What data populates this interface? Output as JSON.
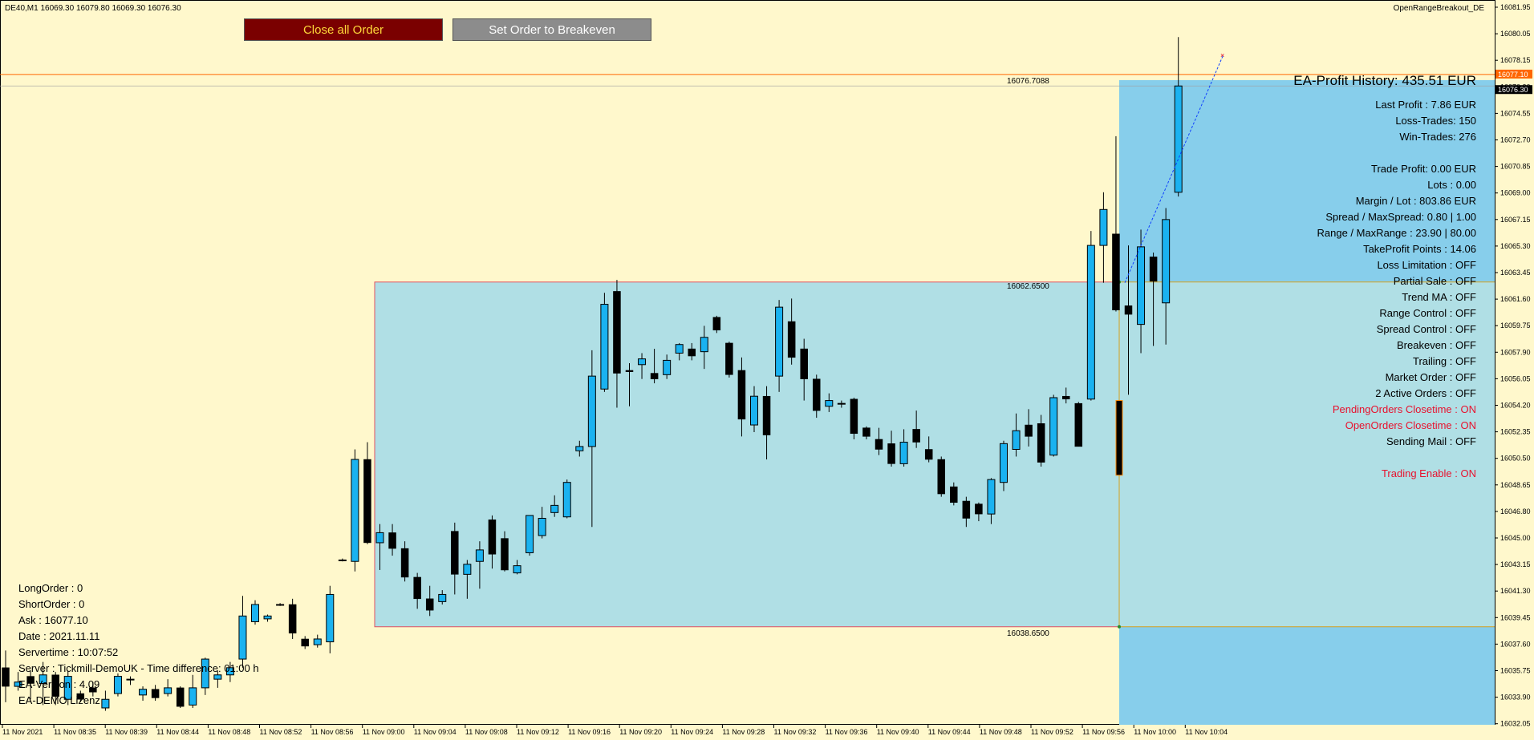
{
  "header": {
    "symbol_info": "DE40,M1  16069.30 16079.80 16069.30 16076.30",
    "ea_name": "OpenRangeBreakout_DE"
  },
  "buttons": {
    "close_all": "Close all Order",
    "breakeven": "Set Order to Breakeven"
  },
  "levels": {
    "high_label": "16076.7088",
    "range_high_label": "16062.6500",
    "range_low_label": "16038.6500",
    "ask_badge": "16077.10",
    "bid_badge": "16076.30"
  },
  "price_axis": [
    "16081.95",
    "16080.05",
    "16078.15",
    "16076.30",
    "16074.55",
    "16072.70",
    "16070.85",
    "16069.00",
    "16067.15",
    "16065.30",
    "16063.45",
    "16061.60",
    "16059.75",
    "16057.90",
    "16056.05",
    "16054.20",
    "16052.35",
    "16050.50",
    "16048.65",
    "16046.80",
    "16045.00",
    "16043.15",
    "16041.30",
    "16039.45",
    "16037.60",
    "16035.75",
    "16033.90",
    "16032.05"
  ],
  "time_axis": [
    "11 Nov 2021",
    "11 Nov 08:35",
    "11 Nov 08:39",
    "11 Nov 08:44",
    "11 Nov 08:48",
    "11 Nov 08:52",
    "11 Nov 08:56",
    "11 Nov 09:00",
    "11 Nov 09:04",
    "11 Nov 09:08",
    "11 Nov 09:12",
    "11 Nov 09:16",
    "11 Nov 09:20",
    "11 Nov 09:24",
    "11 Nov 09:28",
    "11 Nov 09:32",
    "11 Nov 09:36",
    "11 Nov 09:40",
    "11 Nov 09:44",
    "11 Nov 09:48",
    "11 Nov 09:52",
    "11 Nov 09:56",
    "11 Nov 10:00",
    "11 Nov 10:04"
  ],
  "ea_panel": {
    "title": "EA-Profit History: 435.51 EUR",
    "lines": [
      {
        "text": "Last Profit : 7.86 EUR",
        "red": false
      },
      {
        "text": "Loss-Trades:  150",
        "red": false
      },
      {
        "text": "Win-Trades:   276",
        "red": false
      },
      {
        "text": "",
        "red": false
      },
      {
        "text": "Trade Profit:   0.00 EUR",
        "red": false
      },
      {
        "text": "Lots : 0.00",
        "red": false
      },
      {
        "text": "Margin / Lot :   803.86 EUR",
        "red": false
      },
      {
        "text": "Spread / MaxSpread: 0.80 | 1.00",
        "red": false
      },
      {
        "text": "Range / MaxRange : 23.90 | 80.00",
        "red": false
      },
      {
        "text": "TakeProfit Points : 14.06",
        "red": false
      },
      {
        "text": "Loss Limitation : OFF",
        "red": false
      },
      {
        "text": "Partial Sale : OFF",
        "red": false
      },
      {
        "text": "Trend MA : OFF",
        "red": false
      },
      {
        "text": "Range Control : OFF",
        "red": false
      },
      {
        "text": "Spread Control : OFF",
        "red": false
      },
      {
        "text": "Breakeven : OFF",
        "red": false
      },
      {
        "text": "Trailing : OFF",
        "red": false
      },
      {
        "text": "Market Order : OFF",
        "red": false
      },
      {
        "text": "2 Active Orders : OFF",
        "red": false
      },
      {
        "text": "PendingOrders Closetime :  ON",
        "red": true
      },
      {
        "text": "OpenOrders Closetime :  ON",
        "red": true
      },
      {
        "text": "Sending Mail : OFF",
        "red": false
      },
      {
        "text": "",
        "red": false
      },
      {
        "text": "Trading Enable :  ON",
        "red": true
      }
    ]
  },
  "account_info": [
    "LongOrder   : 0",
    "ShortOrder : 0",
    "Ask : 16077.10",
    "Date : 2021.11.11",
    "Servertime : 10:07:52",
    "Server : Tickmill-DemoUK - Time difference: 01:00 h",
    "EA-Version : 4.09",
    "EA-DEMO Lizenz"
  ],
  "colors": {
    "background": "#fff8cc",
    "range_box": "#b0dfe5",
    "breakout_zone": "#87ceeb",
    "bull_candle": "#1ab2f0",
    "bear_candle": "#000000",
    "ask_line": "#ff6600"
  },
  "chart_data": {
    "type": "candlestick",
    "price_range": [
      16032.05,
      16081.95
    ],
    "candles": [
      {
        "o": 16035.8,
        "h": 16037.0,
        "l": 16033.4,
        "c": 16034.5
      },
      {
        "o": 16034.5,
        "h": 16035.5,
        "l": 16034.2,
        "c": 16034.8
      },
      {
        "o": 16035.2,
        "h": 16035.6,
        "l": 16033.6,
        "c": 16034.7
      },
      {
        "o": 16034.7,
        "h": 16036.2,
        "l": 16033.2,
        "c": 16035.3
      },
      {
        "o": 16035.3,
        "h": 16035.5,
        "l": 16033.2,
        "c": 16033.8
      },
      {
        "o": 16033.6,
        "h": 16035.6,
        "l": 16033.2,
        "c": 16035.2
      },
      {
        "o": 16034.0,
        "h": 16034.2,
        "l": 16033.4,
        "c": 16033.6
      },
      {
        "o": 16034.4,
        "h": 16034.8,
        "l": 16033.8,
        "c": 16034.1
      },
      {
        "o": 16033.0,
        "h": 16034.2,
        "l": 16032.8,
        "c": 16033.6
      },
      {
        "o": 16034.0,
        "h": 16035.4,
        "l": 16033.8,
        "c": 16035.2
      },
      {
        "o": 16035.0,
        "h": 16035.2,
        "l": 16034.6,
        "c": 16035.0
      },
      {
        "o": 16033.9,
        "h": 16034.5,
        "l": 16033.5,
        "c": 16034.3
      },
      {
        "o": 16034.3,
        "h": 16034.6,
        "l": 16033.5,
        "c": 16033.7
      },
      {
        "o": 16034.0,
        "h": 16035.0,
        "l": 16033.8,
        "c": 16034.4
      },
      {
        "o": 16034.4,
        "h": 16034.5,
        "l": 16033.0,
        "c": 16033.1
      },
      {
        "o": 16033.2,
        "h": 16035.3,
        "l": 16033.0,
        "c": 16034.4
      },
      {
        "o": 16034.4,
        "h": 16036.5,
        "l": 16033.9,
        "c": 16036.4
      },
      {
        "o": 16035.0,
        "h": 16035.6,
        "l": 16034.4,
        "c": 16035.3
      },
      {
        "o": 16035.3,
        "h": 16036.2,
        "l": 16034.8,
        "c": 16035.8
      },
      {
        "o": 16036.4,
        "h": 16040.8,
        "l": 16035.8,
        "c": 16039.4
      },
      {
        "o": 16039.0,
        "h": 16040.5,
        "l": 16038.8,
        "c": 16040.2
      },
      {
        "o": 16039.2,
        "h": 16039.5,
        "l": 16039.0,
        "c": 16039.4
      },
      {
        "o": 16040.2,
        "h": 16040.3,
        "l": 16040.1,
        "c": 16040.2
      },
      {
        "o": 16040.2,
        "h": 16040.6,
        "l": 16037.8,
        "c": 16038.2
      },
      {
        "o": 16037.8,
        "h": 16038.0,
        "l": 16037.1,
        "c": 16037.3
      },
      {
        "o": 16037.4,
        "h": 16038.1,
        "l": 16037.2,
        "c": 16037.8
      },
      {
        "o": 16037.6,
        "h": 16041.5,
        "l": 16036.8,
        "c": 16040.9
      },
      {
        "o": 16043.3,
        "h": 16043.4,
        "l": 16043.2,
        "c": 16043.3
      },
      {
        "o": 16043.2,
        "h": 16051.0,
        "l": 16042.5,
        "c": 16050.3
      },
      {
        "o": 16050.3,
        "h": 16051.5,
        "l": 16044.4,
        "c": 16044.5
      },
      {
        "o": 16044.5,
        "h": 16045.8,
        "l": 16042.6,
        "c": 16045.2
      },
      {
        "o": 16045.2,
        "h": 16045.8,
        "l": 16043.6,
        "c": 16044.1
      },
      {
        "o": 16044.1,
        "h": 16044.6,
        "l": 16041.8,
        "c": 16042.1
      },
      {
        "o": 16042.1,
        "h": 16042.4,
        "l": 16039.9,
        "c": 16040.6
      },
      {
        "o": 16040.6,
        "h": 16041.5,
        "l": 16039.4,
        "c": 16039.8
      },
      {
        "o": 16040.4,
        "h": 16041.2,
        "l": 16040.2,
        "c": 16040.9
      },
      {
        "o": 16045.3,
        "h": 16045.9,
        "l": 16040.9,
        "c": 16042.3
      },
      {
        "o": 16042.3,
        "h": 16043.3,
        "l": 16040.6,
        "c": 16043.0
      },
      {
        "o": 16043.2,
        "h": 16044.6,
        "l": 16041.3,
        "c": 16044.0
      },
      {
        "o": 16046.1,
        "h": 16046.4,
        "l": 16042.7,
        "c": 16043.7
      },
      {
        "o": 16044.8,
        "h": 16045.3,
        "l": 16042.5,
        "c": 16042.6
      },
      {
        "o": 16042.4,
        "h": 16043.3,
        "l": 16042.3,
        "c": 16042.9
      },
      {
        "o": 16043.8,
        "h": 16046.4,
        "l": 16043.6,
        "c": 16046.4
      },
      {
        "o": 16045.0,
        "h": 16047.0,
        "l": 16044.8,
        "c": 16046.2
      },
      {
        "o": 16046.6,
        "h": 16047.8,
        "l": 16046.3,
        "c": 16047.1
      },
      {
        "o": 16046.3,
        "h": 16048.9,
        "l": 16046.2,
        "c": 16048.7
      },
      {
        "o": 16050.9,
        "h": 16051.6,
        "l": 16050.5,
        "c": 16051.2
      },
      {
        "o": 16051.2,
        "h": 16057.9,
        "l": 16045.6,
        "c": 16056.1
      },
      {
        "o": 16055.2,
        "h": 16061.9,
        "l": 16055.0,
        "c": 16061.1
      },
      {
        "o": 16062.0,
        "h": 16062.8,
        "l": 16053.9,
        "c": 16056.3
      },
      {
        "o": 16056.5,
        "h": 16057.0,
        "l": 16054.0,
        "c": 16056.4
      },
      {
        "o": 16056.9,
        "h": 16057.7,
        "l": 16055.9,
        "c": 16057.3
      },
      {
        "o": 16056.3,
        "h": 16058.0,
        "l": 16055.6,
        "c": 16055.9
      },
      {
        "o": 16056.2,
        "h": 16057.6,
        "l": 16055.9,
        "c": 16057.2
      },
      {
        "o": 16057.7,
        "h": 16058.4,
        "l": 16057.2,
        "c": 16058.3
      },
      {
        "o": 16058.0,
        "h": 16058.4,
        "l": 16057.2,
        "c": 16057.5
      },
      {
        "o": 16057.8,
        "h": 16059.6,
        "l": 16056.6,
        "c": 16058.8
      },
      {
        "o": 16060.2,
        "h": 16060.3,
        "l": 16059.1,
        "c": 16059.3
      },
      {
        "o": 16058.4,
        "h": 16058.5,
        "l": 16056.0,
        "c": 16056.2
      },
      {
        "o": 16056.5,
        "h": 16057.4,
        "l": 16051.9,
        "c": 16053.1
      },
      {
        "o": 16052.7,
        "h": 16055.4,
        "l": 16052.2,
        "c": 16054.7
      },
      {
        "o": 16054.7,
        "h": 16055.4,
        "l": 16050.3,
        "c": 16052.0
      },
      {
        "o": 16056.1,
        "h": 16061.4,
        "l": 16055.0,
        "c": 16060.9
      },
      {
        "o": 16059.9,
        "h": 16061.5,
        "l": 16056.9,
        "c": 16057.4
      },
      {
        "o": 16058.0,
        "h": 16058.7,
        "l": 16054.4,
        "c": 16055.9
      },
      {
        "o": 16055.9,
        "h": 16056.2,
        "l": 16053.2,
        "c": 16053.7
      },
      {
        "o": 16054.0,
        "h": 16054.9,
        "l": 16053.6,
        "c": 16054.4
      },
      {
        "o": 16054.2,
        "h": 16054.4,
        "l": 16053.9,
        "c": 16054.2
      },
      {
        "o": 16054.5,
        "h": 16054.6,
        "l": 16051.7,
        "c": 16052.1
      },
      {
        "o": 16052.5,
        "h": 16052.6,
        "l": 16051.7,
        "c": 16051.9
      },
      {
        "o": 16051.7,
        "h": 16052.5,
        "l": 16050.6,
        "c": 16051.0
      },
      {
        "o": 16051.4,
        "h": 16052.3,
        "l": 16049.8,
        "c": 16050.0
      },
      {
        "o": 16050.0,
        "h": 16052.4,
        "l": 16049.8,
        "c": 16051.5
      },
      {
        "o": 16052.4,
        "h": 16053.7,
        "l": 16051.1,
        "c": 16051.5
      },
      {
        "o": 16051.0,
        "h": 16051.9,
        "l": 16050.1,
        "c": 16050.3
      },
      {
        "o": 16050.3,
        "h": 16050.5,
        "l": 16047.7,
        "c": 16047.9
      },
      {
        "o": 16048.4,
        "h": 16048.7,
        "l": 16047.1,
        "c": 16047.3
      },
      {
        "o": 16047.4,
        "h": 16047.7,
        "l": 16045.6,
        "c": 16046.2
      },
      {
        "o": 16047.2,
        "h": 16047.3,
        "l": 16046.0,
        "c": 16046.5
      },
      {
        "o": 16046.5,
        "h": 16049.0,
        "l": 16045.8,
        "c": 16048.9
      },
      {
        "o": 16048.7,
        "h": 16051.6,
        "l": 16048.1,
        "c": 16051.4
      },
      {
        "o": 16051.0,
        "h": 16053.5,
        "l": 16050.5,
        "c": 16052.3
      },
      {
        "o": 16052.7,
        "h": 16053.8,
        "l": 16051.2,
        "c": 16051.9
      },
      {
        "o": 16052.8,
        "h": 16053.4,
        "l": 16049.8,
        "c": 16050.1
      },
      {
        "o": 16050.6,
        "h": 16054.8,
        "l": 16050.5,
        "c": 16054.6
      },
      {
        "o": 16054.7,
        "h": 16055.3,
        "l": 16054.2,
        "c": 16054.5
      },
      {
        "o": 16054.2,
        "h": 16054.3,
        "l": 16051.2,
        "c": 16051.2
      },
      {
        "o": 16054.5,
        "h": 16066.2,
        "l": 16054.4,
        "c": 16065.2
      },
      {
        "o": 16065.2,
        "h": 16068.9,
        "l": 16062.6,
        "c": 16067.7
      },
      {
        "o": 16066.0,
        "h": 16072.8,
        "l": 16060.6,
        "c": 16060.7
      },
      {
        "o": 16061.0,
        "h": 16065.2,
        "l": 16054.8,
        "c": 16060.4
      },
      {
        "o": 16059.7,
        "h": 16066.3,
        "l": 16057.7,
        "c": 16065.1
      },
      {
        "o": 16064.4,
        "h": 16064.7,
        "l": 16058.2,
        "c": 16062.7
      },
      {
        "o": 16061.2,
        "h": 16067.8,
        "l": 16058.3,
        "c": 16067.0
      },
      {
        "o": 16068.9,
        "h": 16079.7,
        "l": 16068.6,
        "c": 16076.3
      }
    ]
  }
}
